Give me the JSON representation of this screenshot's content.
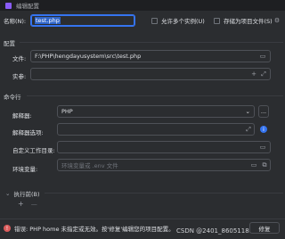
{
  "window": {
    "title": "编辑配置"
  },
  "top": {
    "name_label": "名称(N):",
    "name_value": "test.php",
    "allow_multiple": "允许多个实例(U)",
    "store_as_file": "存储为项目文件(S)"
  },
  "config": {
    "section": "配置",
    "file_label": "文件:",
    "file_value": "F:\\PHP\\hengdayusystem\\src\\test.php",
    "args_label": "实参:",
    "args_value": ""
  },
  "cmd": {
    "section": "命令行",
    "interpreter_label": "解释器:",
    "interpreter_value": "PHP",
    "interpreter_more": "...",
    "options_label": "解释器选项:",
    "workdir_label": "自定义工作目录:",
    "env_label": "环境变量:",
    "env_placeholder": "环境变量或 .env 文件"
  },
  "before": {
    "section": "执行前(B)",
    "add": "+",
    "remove": "—"
  },
  "bottom": {
    "error_text": "错误: PHP home 未指定或无效。按'修复'编辑您的项目配置。",
    "fix_label": "修复"
  },
  "watermark": "CSDN @2401_86051189",
  "icons": {
    "folder": "folder-icon",
    "expand": "expand-icon",
    "copy": "copy-icon",
    "info": "info-icon",
    "error": "error-icon",
    "chevron": "chevron-down-icon"
  }
}
